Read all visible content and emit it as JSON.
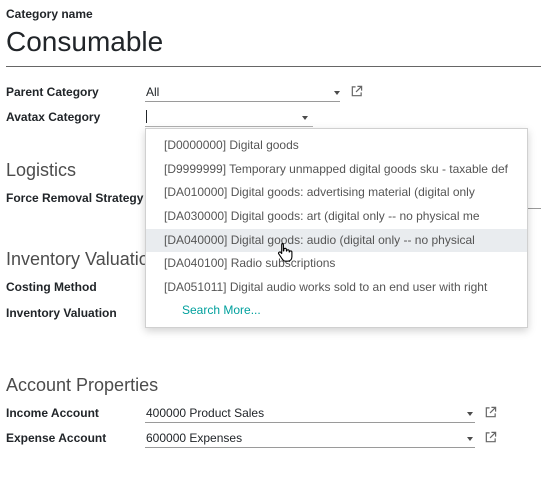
{
  "form": {
    "category_name_label": "Category name",
    "category_name_value": "Consumable",
    "parent_category_label": "Parent Category",
    "parent_category_value": "All",
    "avatax_category_label": "Avatax Category",
    "avatax_category_value": ""
  },
  "sections": {
    "logistics": {
      "title": "Logistics",
      "force_removal_label": "Force Removal Strategy"
    },
    "inventory_valuation": {
      "title": "Inventory Valuation",
      "costing_method_label": "Costing Method",
      "inventory_valuation_label": "Inventory Valuation"
    },
    "account_properties": {
      "title": "Account Properties",
      "income_label": "Income Account",
      "income_value": "400000 Product Sales",
      "expense_label": "Expense Account",
      "expense_value": "600000 Expenses"
    }
  },
  "dropdown": {
    "items": [
      "[D0000000] Digital goods",
      "[D9999999] Temporary unmapped digital goods sku - taxable def",
      "[DA010000] Digital goods: advertising material (digital only",
      "[DA030000] Digital goods: art (digital only -- no physical me",
      "[DA040000] Digital goods: audio (digital only -- no physical",
      "[DA040100] Radio subscriptions",
      "[DA051011] Digital audio works sold to an end user with right"
    ],
    "search_more": "Search More..."
  },
  "colors": {
    "accent": "#00a09d",
    "hover_bg": "#e9ecef",
    "text": "#212529",
    "section_text": "#4c4c4c"
  }
}
